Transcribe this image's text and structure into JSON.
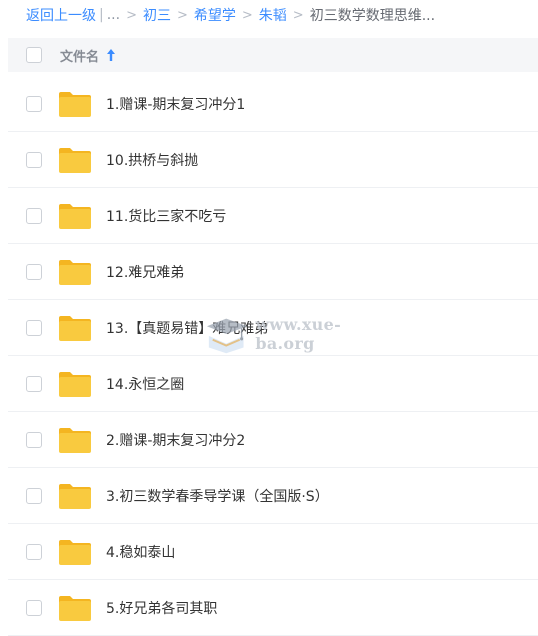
{
  "breadcrumb": {
    "back": "返回上一级",
    "bar": "|",
    "ellipsis": "...",
    "sep": ">",
    "items": [
      "初三",
      "希望学",
      "朱韬"
    ],
    "current": "初三数学数理思维..."
  },
  "header": {
    "column_name": "文件名",
    "sort": "ascending"
  },
  "files": [
    "1.赠课-期末复习冲分1",
    "10.拱桥与斜抛",
    "11.货比三家不吃亏",
    "12.难兄难弟",
    "13.【真题易错】难兄难弟",
    "14.永恒之圈",
    "2.赠课-期末复习冲分2",
    "3.初三数学春季导学课（全国版·S）",
    "4.稳如泰山",
    "5.好兄弟各司其职"
  ],
  "watermark": {
    "text": "www.xue-ba.org"
  },
  "colors": {
    "link": "#3b8cff",
    "folder": "#f9ca3f",
    "folder_tab": "#f4b521"
  }
}
